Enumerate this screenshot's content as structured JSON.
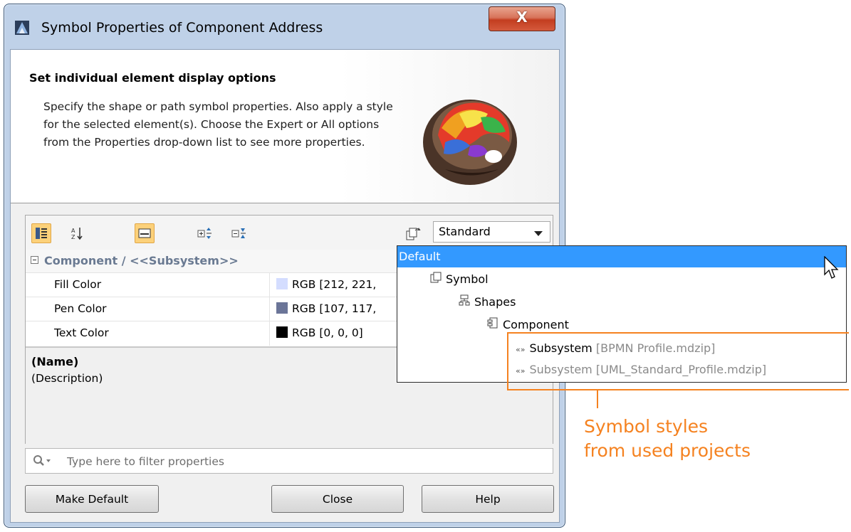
{
  "window": {
    "title": "Symbol Properties of Component Address",
    "close_label": "X"
  },
  "header": {
    "title": "Set individual element display options",
    "description": "Specify the shape or path symbol properties. Also apply a style for the selected element(s). Choose the Expert or All options from the Properties drop-down list to see more properties."
  },
  "toolbar": {
    "view_mode": "Standard"
  },
  "properties": {
    "group": "Component / <<Subsystem>>",
    "rows": [
      {
        "name": "Fill Color",
        "value": "RGB [212, 221,",
        "color": "#d4ddff"
      },
      {
        "name": "Pen Color",
        "value": "RGB [107, 117,",
        "color": "#6b7598"
      },
      {
        "name": "Text Color",
        "value": "RGB [0, 0, 0]",
        "color": "#000000"
      }
    ]
  },
  "description_pane": {
    "name": "(Name)",
    "text": "(Description)"
  },
  "filter": {
    "placeholder": "Type here to filter properties"
  },
  "buttons": {
    "make_default": "Make Default",
    "close": "Close",
    "help": "Help"
  },
  "style_tree": {
    "selected": "Default",
    "symbol": "Symbol",
    "shapes": "Shapes",
    "component": "Component",
    "subsystem1": {
      "name": "Subsystem",
      "source": "[BPMN Profile.mdzip]"
    },
    "subsystem2": {
      "name": "Subsystem",
      "source": "[UML_Standard_Profile.mdzip]"
    }
  },
  "annotation": {
    "line1": "Symbol styles",
    "line2": "from used projects"
  },
  "colors": {
    "selection": "#3399ff",
    "annotation": "#f58220"
  }
}
